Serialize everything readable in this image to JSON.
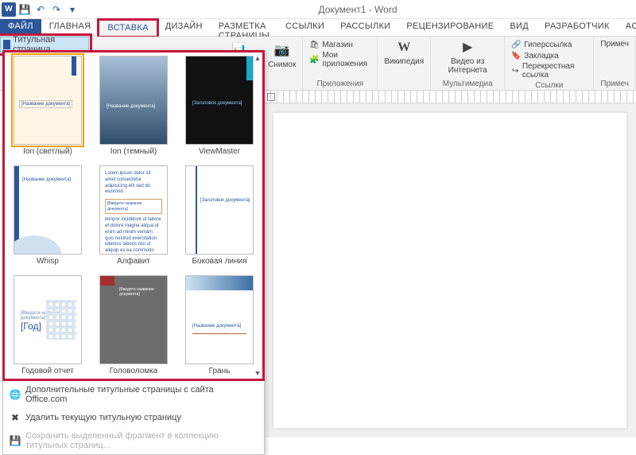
{
  "app": {
    "title": "Документ1 - Word"
  },
  "tabs": {
    "file": "ФАЙЛ",
    "home": "ГЛАВНАЯ",
    "insert": "ВСТАВКА",
    "design": "ДИЗАЙН",
    "layout": "РАЗМЕТКА СТРАНИЦЫ",
    "refs": "ССЫЛКИ",
    "mail": "РАССЫЛКИ",
    "review": "РЕЦЕНЗИРОВАНИЕ",
    "view": "ВИД",
    "dev": "РАЗРАБОТЧИК",
    "acrobat": "ACROBAT"
  },
  "ribbon": {
    "cover_page": "Титульная страница",
    "chart": "Диаграмма",
    "screenshot": "Снимок",
    "store": "Магазин",
    "my_apps": "Мои приложения",
    "wikipedia": "Википедия",
    "online_video": "Видео из Интернета",
    "hyperlink": "Гиперссылка",
    "bookmark": "Закладка",
    "crossref": "Перекрестная ссылка",
    "comment": "Примеч",
    "group_apps": "Приложения",
    "group_media": "Мультимедиа",
    "group_links": "Ссылки",
    "group_comment": "Примеч"
  },
  "gallery": {
    "items": [
      {
        "id": "ion-light",
        "label": "Ion (светлый)",
        "text": "[Название документа]"
      },
      {
        "id": "ion-dark",
        "label": "Ion (темный)",
        "text": "[Название документа]"
      },
      {
        "id": "viewmaster",
        "label": "ViewMaster",
        "text": "[Заголовок документа]"
      },
      {
        "id": "whisp",
        "label": "Whisp",
        "text": "[Название документа]"
      },
      {
        "id": "alpha",
        "label": "Алфавит",
        "text": "[Введите название документа]"
      },
      {
        "id": "side",
        "label": "Боковая линия",
        "text": "[Заголовок документа]"
      },
      {
        "id": "annual",
        "label": "Годовой отчет",
        "text": "[Введите название документа]",
        "year": "[Год]"
      },
      {
        "id": "puzzle",
        "label": "Головоломка",
        "text": "[Введите название документа]"
      },
      {
        "id": "facet",
        "label": "Грань",
        "text": "[Название документа]"
      }
    ],
    "footer": {
      "more": "Дополнительные титульные страницы с сайта Office.com",
      "remove": "Удалить текущую титульную страницу",
      "save_sel": "Сохранить выделенный фрагмент в коллекцию титульных страниц..."
    }
  }
}
